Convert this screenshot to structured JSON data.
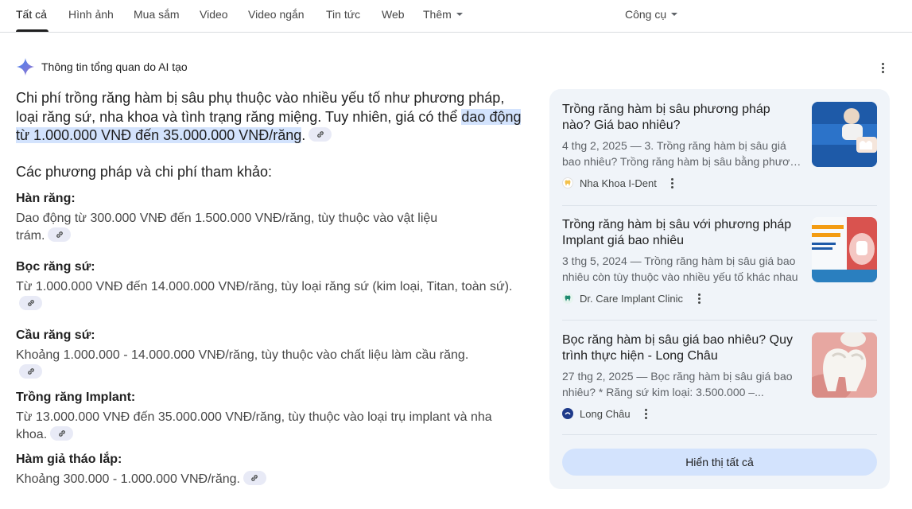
{
  "tabs": [
    "Tất cả",
    "Hình ảnh",
    "Mua sắm",
    "Video",
    "Video ngắn",
    "Tin tức",
    "Web",
    "Thêm"
  ],
  "tools_label": "Công cụ",
  "ai_overview": {
    "header": "Thông tin tổng quan do AI tạo",
    "intro_plain": "Chi phí trồng răng hàm bị sâu phụ thuộc vào nhiều yếu tố như phương pháp, loại răng sứ, nha khoa và tình trạng răng miệng. Tuy nhiên, giá có thể ",
    "intro_highlight": "dao động từ 1.000.000 VNĐ đến 35.000.000 VNĐ/răng",
    "intro_end": ".",
    "section_title": "Các phương pháp và chi phí tham khảo:",
    "items": [
      {
        "heading": "Hàn răng:",
        "body": "Dao động từ 300.000 VNĐ đến 1.500.000 VNĐ/răng, tùy thuộc vào vật liệu trám."
      },
      {
        "heading": "Bọc răng sứ:",
        "body": "Từ 1.000.000 VNĐ đến 14.000.000 VNĐ/răng, tùy loại răng sứ (kim loại, Titan, toàn sứ)."
      },
      {
        "heading": "Cầu răng sứ:",
        "body": "Khoảng 1.000.000 - 14.000.000 VNĐ/răng, tùy thuộc vào chất liệu làm cầu răng."
      },
      {
        "heading": "Trồng răng Implant:",
        "body": "Từ 13.000.000 VNĐ đến 35.000.000 VNĐ/răng, tùy thuộc vào loại trụ implant và nha khoa."
      },
      {
        "heading": "Hàm giả tháo lắp:",
        "body": "Khoảng 300.000 - 1.000.000 VNĐ/răng."
      }
    ]
  },
  "sources": [
    {
      "title": "Trồng răng hàm bị sâu phương pháp nào? Giá bao nhiêu?",
      "snippet_line1": "4 thg 2, 2025 — 3. Trồng răng hàm bị sâu giá",
      "snippet_line2": "bao nhiêu? Trồng răng hàm bị sâu bằng phương pháp",
      "site": "Nha Khoa I-Dent",
      "thumb_text": "G RĂNG HÀM BỊ SÂU PHƯƠNG PHÁP NÀO?"
    },
    {
      "title": "Trồng răng hàm bị sâu với phương pháp Implant giá bao nhiêu",
      "snippet_line1": "3 thg 5, 2024 — Trồng răng hàm bị sâu giá bao",
      "snippet_line2": "nhiêu còn tùy thuộc vào nhiều yếu tố khác nhau",
      "site": "Dr. Care Implant Clinic",
      "thumb_text": "RĂNG HÀM BỊ SÂU G PHÁP IMPLANT O NHIÊU?"
    },
    {
      "title": "Bọc răng hàm bị sâu giá bao nhiêu? Quy trình thực hiện - Long Châu",
      "snippet_line1": "27 thg 2, 2025 — Bọc răng hàm bị sâu giá bao",
      "snippet_line2": "nhiêu? * Răng sứ kim loại: 3.500.000 –...",
      "site": "Long Châu",
      "thumb_text": ""
    }
  ],
  "show_all_label": "Hiển thị tất cả",
  "colors": {
    "highlight": "#d3e3fd",
    "panel_bg": "#f0f4f9",
    "ai_star": "#4285f4"
  }
}
